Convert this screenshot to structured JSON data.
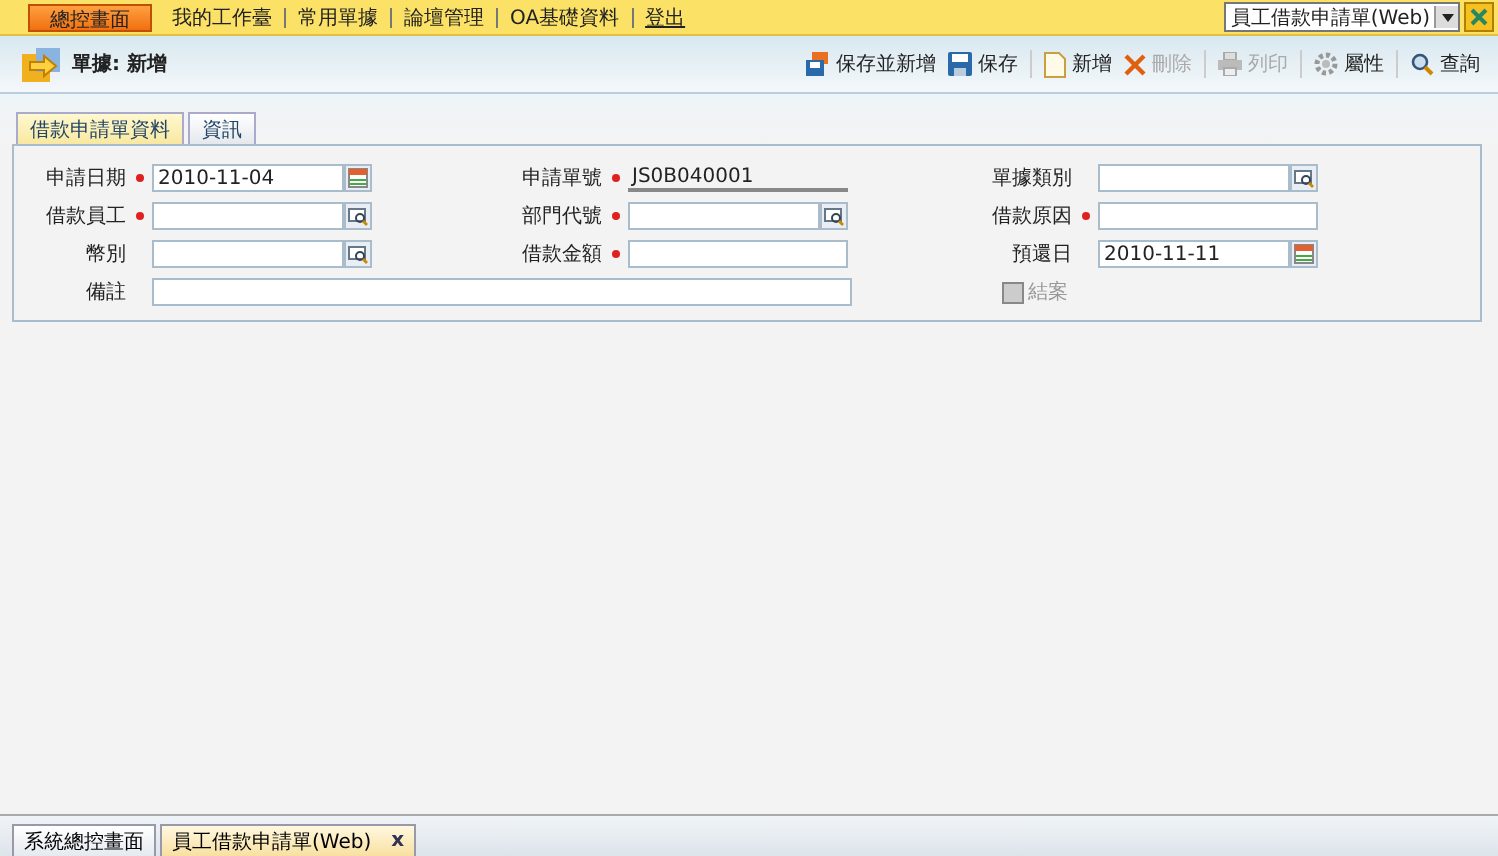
{
  "top_nav": {
    "home_button": "總控畫面",
    "links": [
      {
        "label": "我的工作臺",
        "kind": "plain"
      },
      {
        "label": "常用單據",
        "kind": "plain"
      },
      {
        "label": "論壇管理",
        "kind": "plain"
      },
      {
        "label": "OA基礎資料",
        "kind": "plain"
      },
      {
        "label": "登出",
        "kind": "underlined"
      }
    ],
    "window_select": "員工借款申請單(Web)"
  },
  "header": {
    "title": "單據: 新增"
  },
  "toolbar": [
    {
      "label": "保存並新增",
      "kind": "save-new",
      "disabled": false,
      "separator_before": false
    },
    {
      "label": "保存",
      "kind": "save",
      "disabled": false,
      "separator_before": false
    },
    {
      "label": "新增",
      "kind": "new",
      "disabled": false,
      "separator_before": true
    },
    {
      "label": "刪除",
      "kind": "delete",
      "disabled": true,
      "separator_before": false
    },
    {
      "label": "列印",
      "kind": "print",
      "disabled": true,
      "separator_before": true
    },
    {
      "label": "屬性",
      "kind": "gear",
      "disabled": false,
      "separator_before": true
    },
    {
      "label": "查詢",
      "kind": "search",
      "disabled": false,
      "separator_before": true
    }
  ],
  "tabs": [
    {
      "label": "借款申請單資料",
      "selected": true
    },
    {
      "label": "資訊",
      "selected": false
    }
  ],
  "form_rows": [
    [
      {
        "label": "申請日期",
        "required": true,
        "kind": "date",
        "value": "2010-11-04"
      },
      {
        "label": "申請單號",
        "required": true,
        "kind": "readonly",
        "value": "JS0B040001"
      },
      {
        "label": "單據類別",
        "required": false,
        "kind": "lookup"
      }
    ],
    [
      {
        "label": "借款員工",
        "required": true,
        "kind": "lookup"
      },
      {
        "label": "部門代號",
        "required": true,
        "kind": "lookup"
      },
      {
        "label": "借款原因",
        "required": true,
        "kind": "text"
      }
    ],
    [
      {
        "label": "幣別",
        "required": false,
        "kind": "lookup"
      },
      {
        "label": "借款金額",
        "required": true,
        "kind": "text"
      },
      {
        "label": "預還日",
        "required": false,
        "kind": "date",
        "value": "2010-11-11"
      }
    ]
  ],
  "remark": {
    "label": "備註"
  },
  "closed_checkbox": {
    "label": "結案",
    "checked": false,
    "disabled": true
  },
  "bottom_tabs": [
    {
      "label": "系統總控畫面",
      "selected": false
    },
    {
      "label": "員工借款申請單(Web)",
      "selected": true,
      "close": "x"
    }
  ]
}
